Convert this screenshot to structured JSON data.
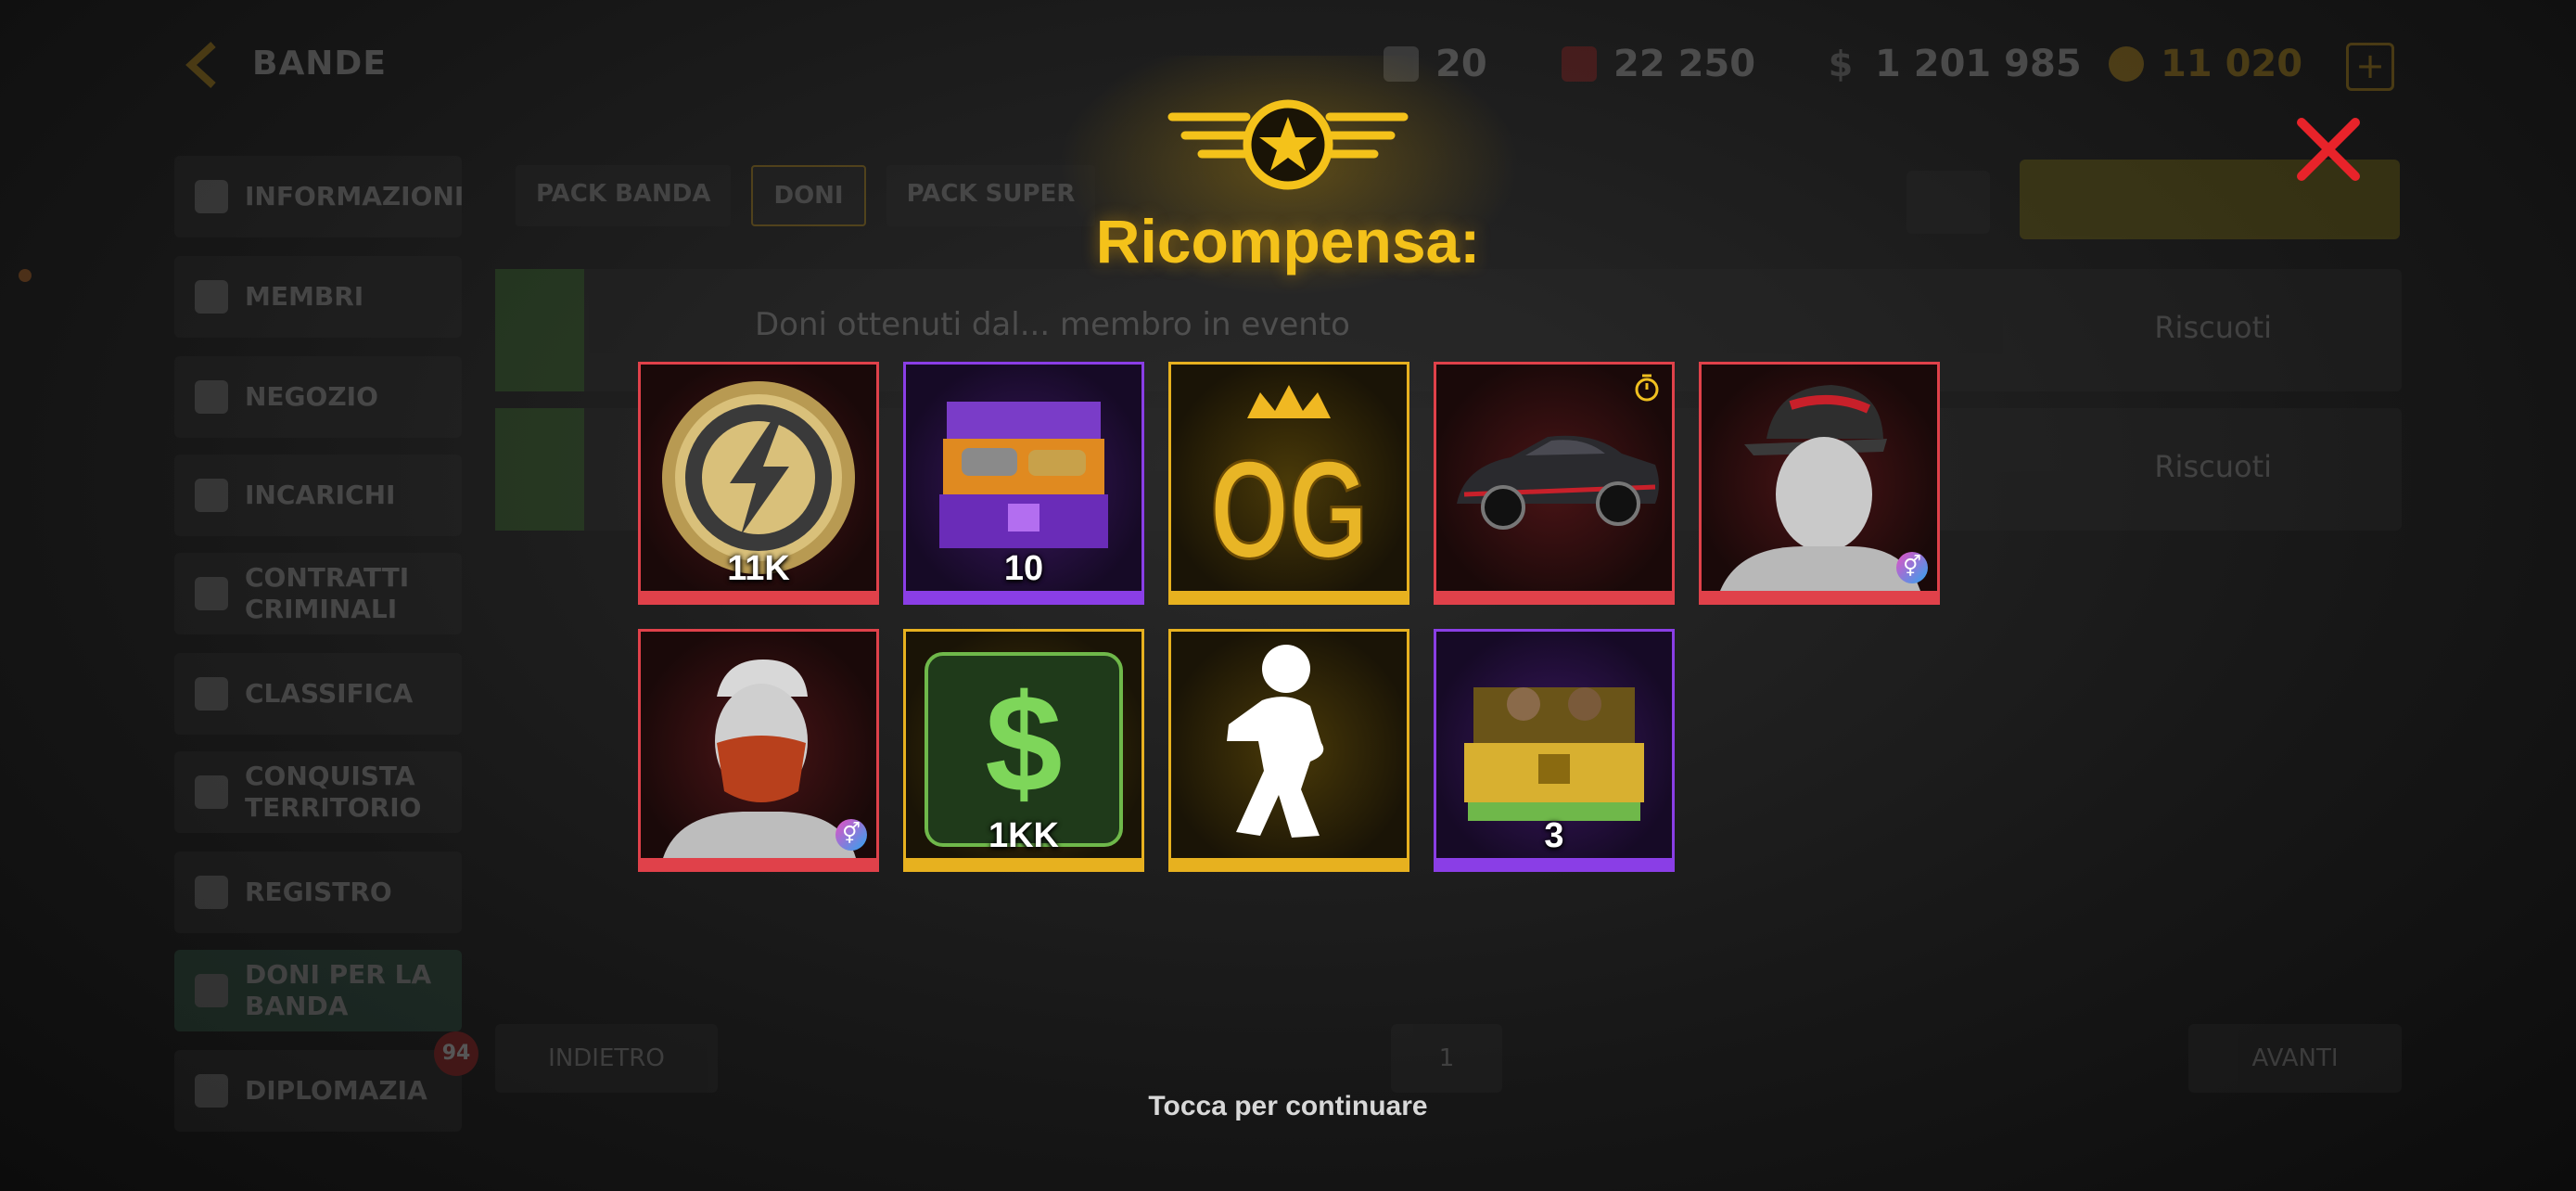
{
  "app": {
    "title": "BANDE",
    "resources": [
      {
        "icon": "level-icon",
        "value": "20",
        "color": "#888888"
      },
      {
        "icon": "health-icon",
        "value": "22 250",
        "color": "#b22222"
      },
      {
        "icon": "dollar-icon",
        "value": "1 201 985",
        "color": "#888888"
      },
      {
        "icon": "coin-icon",
        "value": "11 020",
        "color": "#d4a017"
      }
    ],
    "plus_label": "+"
  },
  "sidebar": {
    "items": [
      {
        "label": "INFORMAZIONI",
        "icon": "shield-icon"
      },
      {
        "label": "MEMBRI",
        "icon": "members-icon"
      },
      {
        "label": "NEGOZIO",
        "icon": "cart-icon"
      },
      {
        "label": "INCARICHI",
        "icon": "clipboard-icon"
      },
      {
        "label": "CONTRATTI CRIMINALI",
        "icon": "building-icon"
      },
      {
        "label": "CLASSIFICA",
        "icon": "podium-icon"
      },
      {
        "label": "CONQUISTA TERRITORIO",
        "icon": "flag-icon"
      },
      {
        "label": "REGISTRO",
        "icon": "log-icon"
      },
      {
        "label": "DONI PER LA BANDA",
        "icon": "gift-icon"
      },
      {
        "label": "DIPLOMAZIA",
        "icon": "scales-icon"
      }
    ],
    "badge": "94"
  },
  "tabs": [
    "PACK BANDA",
    "DONI",
    "PACK SUPER"
  ],
  "content": {
    "rows": [
      {
        "text": "Doni ottenuti dal... membro in evento",
        "status": "Riscuoti"
      },
      {
        "text": "",
        "status": "Riscuoti"
      }
    ],
    "pager": {
      "prev": "INDIETRO",
      "page": "1",
      "next": "AVANTI"
    }
  },
  "modal": {
    "title": "Ricompensa:",
    "continue": "Tocca per continuare",
    "rewards": [
      {
        "name": "energy-coin",
        "rarity": "red",
        "qty": "11K"
      },
      {
        "name": "car-chest",
        "rarity": "purple",
        "qty": "10"
      },
      {
        "name": "og-badge",
        "rarity": "gold",
        "qty": ""
      },
      {
        "name": "sports-car",
        "rarity": "red",
        "qty": ""
      },
      {
        "name": "cap-avatar",
        "rarity": "red",
        "qty": ""
      },
      {
        "name": "mask-avatar",
        "rarity": "red",
        "qty": ""
      },
      {
        "name": "cash",
        "rarity": "gold",
        "qty": "1KK"
      },
      {
        "name": "dance-emote",
        "rarity": "gold",
        "qty": ""
      },
      {
        "name": "cash-chest",
        "rarity": "purple",
        "qty": "3"
      }
    ],
    "colors": {
      "red": "#e0414a",
      "purple": "#8a3ee6",
      "gold": "#e7b11f",
      "title": "#f4c21a"
    }
  }
}
